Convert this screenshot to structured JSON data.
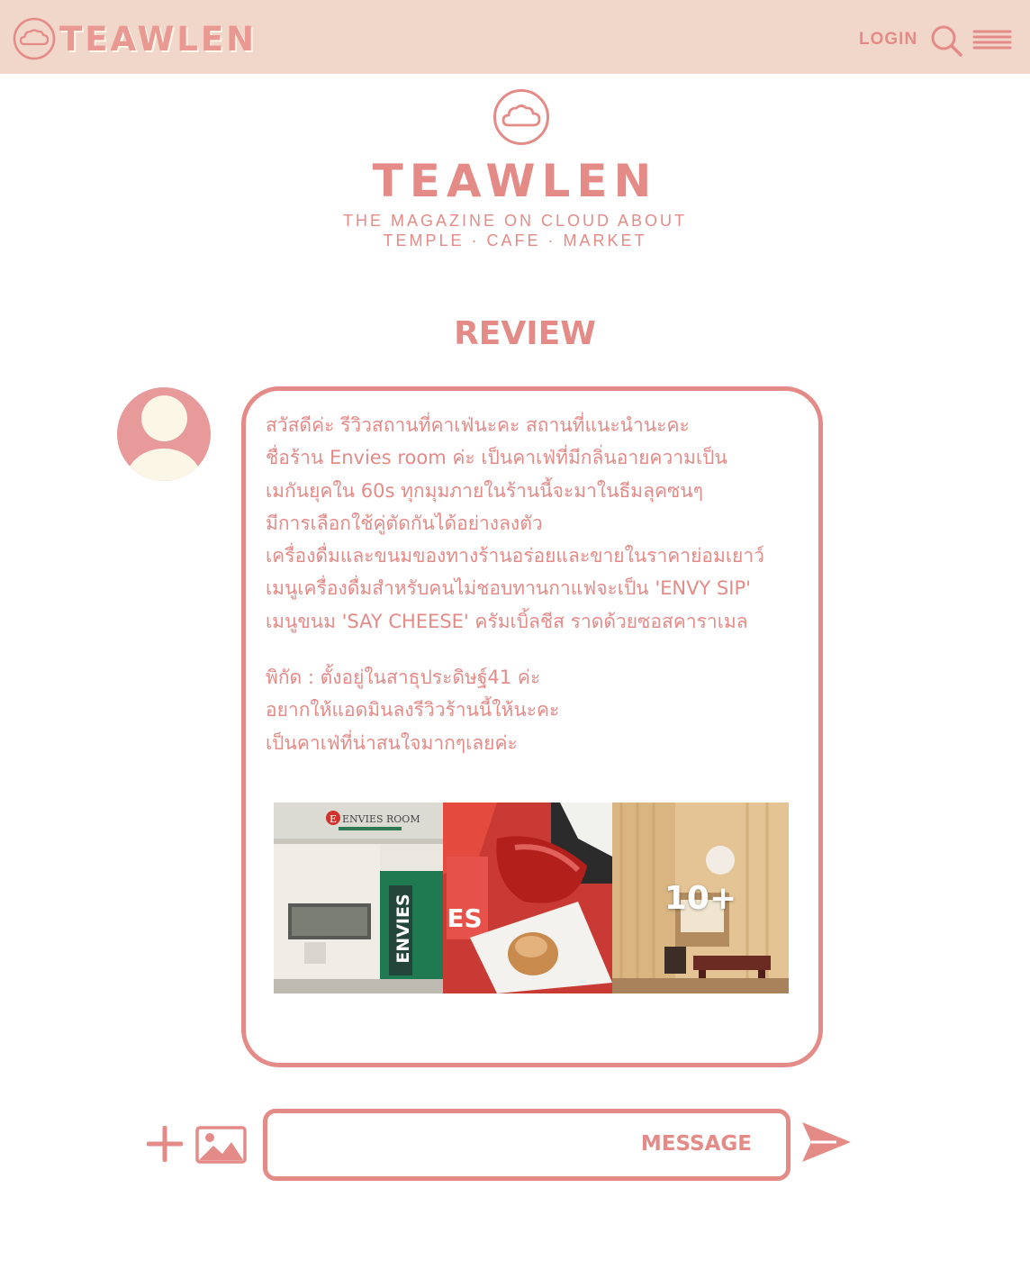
{
  "header": {
    "brand": "TEAWLEN",
    "login_label": "LOGIN",
    "icons": {
      "logo": "cloud-logo-icon",
      "search": "search-icon",
      "menu": "hamburger-menu-icon"
    }
  },
  "hero": {
    "title": "TEAWLEN",
    "tagline_1": "THE MAGAZINE ON CLOUD ABOUT",
    "tagline_2": "TEMPLE · CAFE · MARKET"
  },
  "section": {
    "title": "REVIEW"
  },
  "review": {
    "avatar": "user-avatar",
    "lines": [
      "  สวัสดีค่ะ  รีวิวสถานที่คาเฟ่นะคะ สถานที่แนะนำนะคะ",
      "ชื่อร้าน Envies room ค่ะ เป็นคาเฟ่ที่มีกลิ่นอายความเป็น",
      "เมกันยุคใน 60s ทุกมุมภายในร้านนี้จะมาในธีมลุคซนๆ",
      "มีการเลือกใช้คู่ตัดกันได้อย่างลงตัว",
      "เครื่องดื่มและขนมของทางร้านอร่อยและขายในราคาย่อมเยาว์",
      "เมนูเครื่องดื่มสำหรับคนไม่ชอบทานกาแฟจะเป็น 'ENVY SIP'",
      "เมนูขนม 'SAY CHEESE' ครัมเบิ้ลชีส ราดด้วยซอสคาราเมล"
    ],
    "location_lines": [
      "พิกัด : ตั้งอยู่ในสาธุประดิษฐ์41 ค่ะ",
      "อยากให้แอดมินลงรีวิวร้านนี้ให้นะคะ",
      "เป็นคาเฟ่ที่น่าสนใจมากๆเลยค่ะ"
    ],
    "photos": {
      "shop_sign": "ENVIES ROOM",
      "door_text": "ENVIES",
      "cup_text": "ES",
      "more_count": "10+"
    }
  },
  "composer": {
    "placeholder": "MESSAGE",
    "value": "",
    "icons": {
      "add": "plus-icon",
      "image": "image-icon",
      "send": "send-icon"
    }
  },
  "colors": {
    "accent": "#e48b88",
    "header_bg": "#f1d6ca",
    "avatar_bg": "#e8999a",
    "avatar_fg": "#fbf6e6"
  }
}
